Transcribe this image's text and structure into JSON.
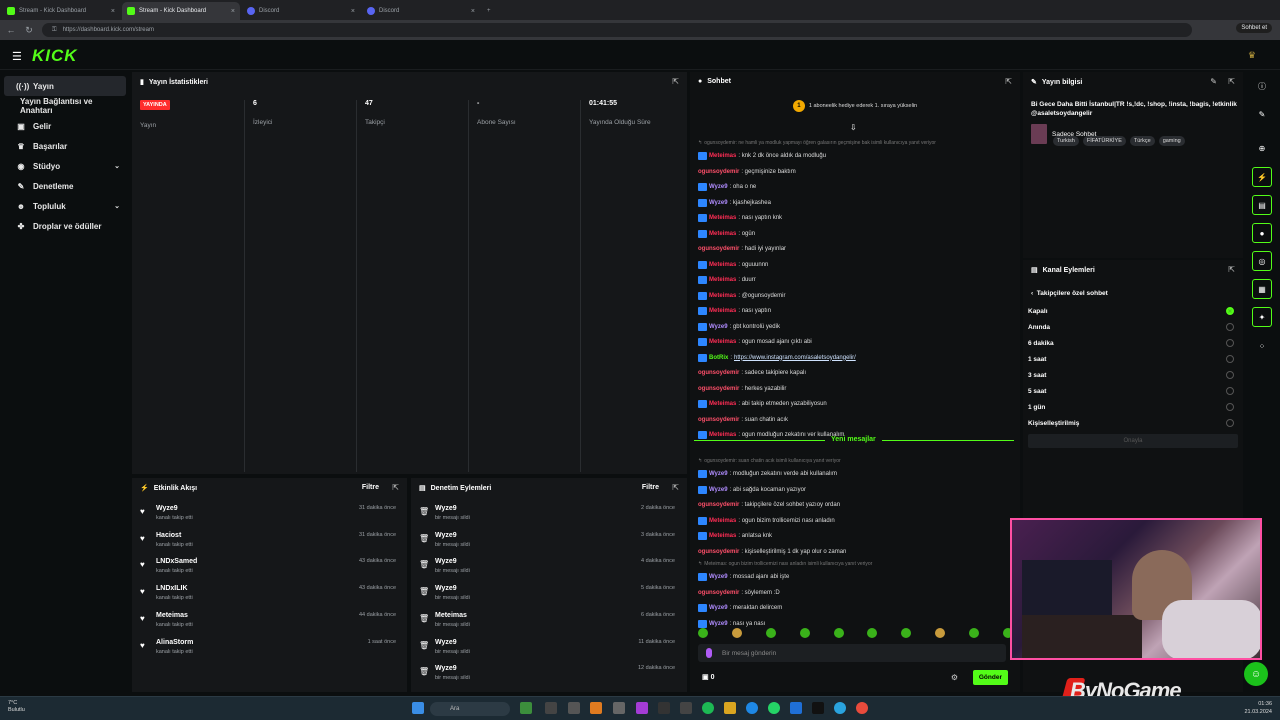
{
  "browser": {
    "tabs": [
      {
        "title": "Stream - Kick Dashboard",
        "active": false,
        "icon": "kick"
      },
      {
        "title": "Stream - Kick Dashboard",
        "active": true,
        "icon": "kick"
      },
      {
        "title": "Discord",
        "active": false,
        "icon": "discord"
      },
      {
        "title": "Discord",
        "active": false,
        "icon": "discord"
      }
    ],
    "url": "https://dashboard.kick.com/stream",
    "profile_label": "Sohbet et"
  },
  "brand": {
    "logo": "KICK",
    "accent": "#53fc18"
  },
  "sidebar": {
    "items": [
      {
        "label": "Yayın",
        "icon": "broadcast-icon",
        "active": true
      },
      {
        "label": "Yayın Bağlantısı ve Anahtarı",
        "icon": "",
        "sub": true
      },
      {
        "label": "Gelir",
        "icon": "wallet-icon"
      },
      {
        "label": "Başarılar",
        "icon": "trophy-icon"
      },
      {
        "label": "Stüdyo",
        "icon": "studio-icon",
        "chevron": true
      },
      {
        "label": "Denetleme",
        "icon": "wrench-icon"
      },
      {
        "label": "Topluluk",
        "icon": "community-icon",
        "chevron": true
      },
      {
        "label": "Droplar ve ödüller",
        "icon": "gift-icon"
      }
    ]
  },
  "stats": {
    "title": "Yayın İstatistikleri",
    "items": [
      {
        "value": "YAYINDA",
        "label": "Yayın"
      },
      {
        "value": "6",
        "label": "İzleyici"
      },
      {
        "value": "47",
        "label": "Takipçi"
      },
      {
        "value": "-",
        "label": "Abone Sayısı"
      },
      {
        "value": "01:41:55",
        "label": "Yayında Olduğu Süre"
      }
    ]
  },
  "activity": {
    "title": "Etkinlik Akışı",
    "filter": "Filtre",
    "rows": [
      {
        "name": "Wyze9",
        "sub": "kanalı takip etti",
        "time": "31 dakika önce"
      },
      {
        "name": "Haciost",
        "sub": "kanalı takip etti",
        "time": "31 dakika önce"
      },
      {
        "name": "LNDxSamed",
        "sub": "kanalı takip etti",
        "time": "43 dakika önce"
      },
      {
        "name": "LNDxILIK",
        "sub": "kanalı takip etti",
        "time": "43 dakika önce"
      },
      {
        "name": "Meteimas",
        "sub": "kanalı takip etti",
        "time": "44 dakika önce"
      },
      {
        "name": "AlinaStorm",
        "sub": "kanalı takip etti",
        "time": "1 saat önce"
      }
    ]
  },
  "moderation": {
    "title": "Denetim Eylemleri",
    "filter": "Filtre",
    "rows": [
      {
        "name": "Wyze9",
        "sub": "bir mesajı sildi",
        "time": "2 dakika önce"
      },
      {
        "name": "Wyze9",
        "sub": "bir mesajı sildi",
        "time": "3 dakika önce"
      },
      {
        "name": "Wyze9",
        "sub": "bir mesajı sildi",
        "time": "4 dakika önce"
      },
      {
        "name": "Wyze9",
        "sub": "bir mesajı sildi",
        "time": "5 dakika önce"
      },
      {
        "name": "Meteimas",
        "sub": "bir mesajı sildi",
        "time": "6 dakika önce"
      },
      {
        "name": "Wyze9",
        "sub": "bir mesajı sildi",
        "time": "11 dakika önce"
      },
      {
        "name": "Wyze9",
        "sub": "bir mesajı sildi",
        "time": "12 dakika önce"
      }
    ]
  },
  "chat": {
    "title": "Sohbet",
    "pinned_count": "1",
    "pinned_text": "1 aboneelik hediye ederek 1. sıraya yükselin",
    "new_messages_label": "Yeni mesajlar",
    "colors": {
      "owner": "#ff4f6a",
      "blue": "#b08cff",
      "red": "#ff2d55"
    },
    "messages": [
      {
        "type": "reply",
        "text": "ogunsoydemir: ne hamli ya modluk yapmayı öğren galasırın geçmişine bak isimli kullanıcıya yanıt veriyor"
      },
      {
        "user": "Meteimas",
        "badge": true,
        "color": "#ff2d55",
        "text": ": knk 2 dk önce aldık da modluğu"
      },
      {
        "user": "ogunsoydemir",
        "badge": false,
        "color": "#ff4f6a",
        "text": ": geçmişinize baktım"
      },
      {
        "user": "Wyze9",
        "badge": true,
        "color": "#b08cff",
        "text": ": oha o ne"
      },
      {
        "user": "Wyze9",
        "badge": true,
        "color": "#b08cff",
        "text": ": kjashejkashea"
      },
      {
        "user": "Meteimas",
        "badge": true,
        "color": "#ff2d55",
        "text": ": nası yaptın knk"
      },
      {
        "user": "Meteimas",
        "badge": true,
        "color": "#ff2d55",
        "text": ": ogün"
      },
      {
        "user": "ogunsoydemir",
        "badge": false,
        "color": "#ff4f6a",
        "text": ": hadi iyi yayınlar"
      },
      {
        "user": "Meteimas",
        "badge": true,
        "color": "#ff2d55",
        "text": ": oguuunnn"
      },
      {
        "user": "Meteimas",
        "badge": true,
        "color": "#ff2d55",
        "text": ": duurr"
      },
      {
        "user": "Meteimas",
        "badge": true,
        "color": "#ff2d55",
        "text": ": @ogunsoydemir"
      },
      {
        "user": "Meteimas",
        "badge": true,
        "color": "#ff2d55",
        "text": ": nası yaptın"
      },
      {
        "user": "Wyze9",
        "badge": true,
        "color": "#b08cff",
        "text": ": gbt kontrolü yedik"
      },
      {
        "user": "Meteimas",
        "badge": true,
        "color": "#ff2d55",
        "text": ": ogun mosad ajanı çıktı abi"
      },
      {
        "user": "BotRix",
        "badge": true,
        "color": "#53fc18",
        "text": ": ",
        "link": "https://www.instagram.com/asaletsoydangelir/"
      },
      {
        "user": "ogunsoydemir",
        "badge": false,
        "color": "#ff4f6a",
        "text": ": sadece takipiere kapalı"
      },
      {
        "user": "ogunsoydemir",
        "badge": false,
        "color": "#ff4f6a",
        "text": ": herkes yazabilir"
      },
      {
        "user": "Meteimas",
        "badge": true,
        "color": "#ff2d55",
        "text": ": abi takip etmeden yazabiliyosun"
      },
      {
        "user": "ogunsoydemir",
        "badge": false,
        "color": "#ff4f6a",
        "text": ": suan chatin acık"
      },
      {
        "user": "Meteimas",
        "badge": true,
        "color": "#ff2d55",
        "text": ": ogun modluğun zekatını ver kullanalım"
      }
    ],
    "messages_after": [
      {
        "type": "reply",
        "text": "ogunsoydemir: suan chatin acık isimli kullanıcıya yanıt veriyor"
      },
      {
        "user": "Wyze9",
        "badge": true,
        "color": "#b08cff",
        "text": ": modluğun zekatını verde abi kullanalım"
      },
      {
        "user": "Wyze9",
        "badge": true,
        "color": "#b08cff",
        "text": ": abi sağda kocaman yazıyor"
      },
      {
        "user": "ogunsoydemir",
        "badge": false,
        "color": "#ff4f6a",
        "text": ": takipçilere özel sohbet yazıoy ordan"
      },
      {
        "user": "Meteimas",
        "badge": true,
        "color": "#ff2d55",
        "text": ": ogun bizim trollicemizi nası anladın"
      },
      {
        "user": "Meteimas",
        "badge": true,
        "color": "#ff2d55",
        "text": ": anlatsa knk"
      },
      {
        "user": "ogunsoydemir",
        "badge": false,
        "color": "#ff4f6a",
        "text": ": kişiselleştirilmiş 1 dk yap olur o zaman"
      },
      {
        "type": "reply",
        "text": "Meteimas: ogun bizim trollicemizi nası anladın isimli kullanıcıya yanıt veriyor"
      },
      {
        "user": "Wyze9",
        "badge": true,
        "color": "#b08cff",
        "text": ": mossad ajanı abi işte"
      },
      {
        "user": "ogunsoydemir",
        "badge": false,
        "color": "#ff4f6a",
        "text": ": söylemem :D"
      },
      {
        "user": "Wyze9",
        "badge": true,
        "color": "#b08cff",
        "text": ": meraktan delircem"
      },
      {
        "user": "Wyze9",
        "badge": true,
        "color": "#b08cff",
        "text": ": nası ya nası"
      }
    ],
    "input_placeholder": "Bir mesaj gönderin",
    "points": "0",
    "send_label": "Gönder"
  },
  "info": {
    "title": "Yayın bilgisi",
    "stream_title": "Bi Gece Daha Bitti İstanbul|TR !s,!dc, !shop, !insta, !bagis, !etkinlik @asaletsoydangelir",
    "category": "Sadece Sohbet",
    "tags": [
      "Turkish",
      "FİFATÜRKİYE",
      "Türkçe",
      "gaming"
    ]
  },
  "actions": {
    "title": "Kanal Eylemleri",
    "back_label": "Takipçilere özel sohbet",
    "options": [
      {
        "label": "Kapalı",
        "selected": true
      },
      {
        "label": "Anında",
        "selected": false
      },
      {
        "label": "6 dakika",
        "selected": false
      },
      {
        "label": "1 saat",
        "selected": false
      },
      {
        "label": "3 saat",
        "selected": false
      },
      {
        "label": "5 saat",
        "selected": false
      },
      {
        "label": "1 gün",
        "selected": false
      },
      {
        "label": "Kişiselleştirilmiş",
        "selected": false
      }
    ],
    "confirm_label": "Onayla"
  },
  "overlay": {
    "watermark": "ByNoGame"
  },
  "taskbar": {
    "weather_temp": "7°C",
    "weather_desc": "Bulutlu",
    "search": "Ara",
    "time": "01:36",
    "date": "21.03.2024"
  }
}
